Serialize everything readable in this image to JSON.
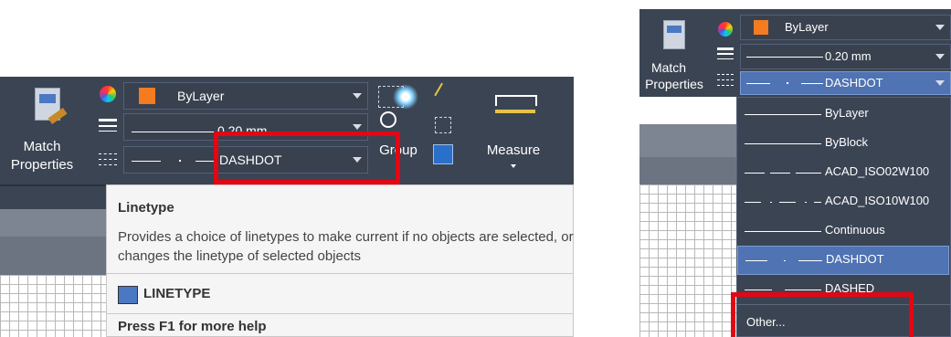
{
  "left": {
    "match_properties_label_1": "Match",
    "match_properties_label_2": "Properties",
    "color_combo_value": "ByLayer",
    "color_swatch": "#f47b20",
    "lineweight_value": "0.20 mm",
    "linetype_value": "DASHDOT",
    "group_label": "Group",
    "measure_label": "Measure",
    "tooltip": {
      "title": "Linetype",
      "description": "Provides a choice of linetypes to make current if no objects are selected, or changes the linetype of selected objects",
      "command": "LINETYPE",
      "help": "Press F1 for more help"
    }
  },
  "right": {
    "match_properties_label_1": "Match",
    "match_properties_label_2": "Properties",
    "color_combo_value": "ByLayer",
    "color_swatch": "#f47b20",
    "lineweight_value": "0.20 mm",
    "linetype_value": "DASHDOT",
    "linetype_options": [
      "ByLayer",
      "ByBlock",
      "ACAD_ISO02W100",
      "ACAD_ISO10W100",
      "Continuous",
      "DASHDOT",
      "DASHED"
    ],
    "selected_option": "DASHDOT",
    "other_option": "Other..."
  },
  "colors": {
    "ribbon_bg": "#3b4453",
    "highlight": "#e30613",
    "selected_item": "#4f73b3"
  }
}
